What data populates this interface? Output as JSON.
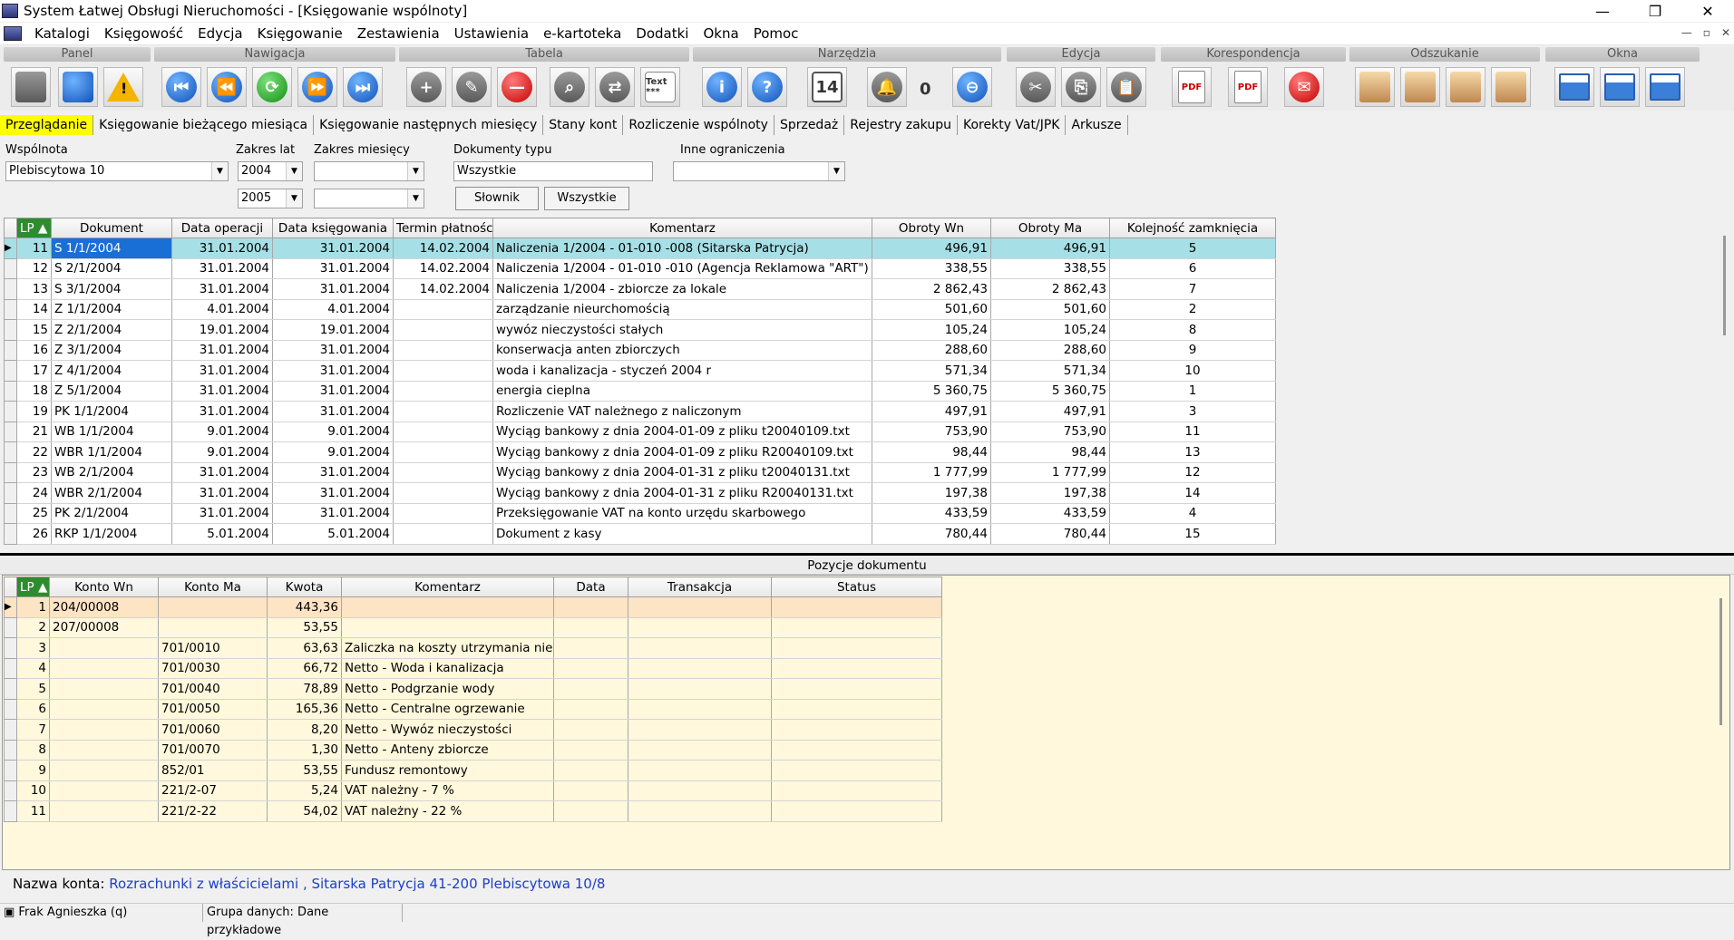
{
  "window": {
    "title": "System Łatwej Obsługi Nieruchomości - [Księgowanie wspólnoty]",
    "min": "—",
    "max": "❐",
    "close": "✕"
  },
  "menu": [
    "Katalogi",
    "Księgowość",
    "Edycja",
    "Księgowanie",
    "Zestawienia",
    "Ustawienia",
    "e-kartoteka",
    "Dodatki",
    "Okna",
    "Pomoc"
  ],
  "mdi": {
    "min": "—",
    "restore": "▫",
    "close": "✕"
  },
  "toolbar_groups": {
    "panel": "Panel",
    "nawigacja": "Nawigacja",
    "tabela": "Tabela",
    "narzedzia": "Narzędzia",
    "edycja": "Edycja",
    "korespondencja": "Korespondencja",
    "odszukanie": "Odszukanie",
    "okna": "Okna"
  },
  "toolbar_glyphs": {
    "first": "⏮",
    "prev": "⏪",
    "refresh": "⟳",
    "next": "⏩",
    "last": "⏭",
    "add": "+",
    "edit": "✎",
    "delete": "—",
    "binoculars": "⌕",
    "exchange": "⇄",
    "text": "Text ***",
    "info": "i",
    "help": "?",
    "calendar": "14",
    "bell": "🔔",
    "minus": "⊖",
    "cut": "✂",
    "copy": "⎘",
    "paste": "📋",
    "pdf1": "PDF",
    "pdf2": "PDF",
    "mail": "✉",
    "notif_count": "0"
  },
  "tabs": [
    "Przeglądanie",
    "Księgowanie bieżącego miesiąca",
    "Księgowanie następnych miesięcy",
    "Stany kont",
    "Rozliczenie wspólnoty",
    "Sprzedaż",
    "Rejestry zakupu",
    "Korekty Vat/JPK",
    "Arkusze"
  ],
  "filters": {
    "wspolnota_label": "Wspólnota",
    "wspolnota_value": "Plebiscytowa 10",
    "zakres_lat_label": "Zakres lat",
    "rok_od": "2004",
    "rok_do": "2005",
    "zakres_miesiecy_label": "Zakres miesięcy",
    "miesiac_od": "",
    "miesiac_do": "",
    "dokumenty_label": "Dokumenty typu",
    "dokumenty_value": "Wszystkie",
    "inne_label": "Inne ograniczenia",
    "inne_value": "",
    "slownik_btn": "Słownik",
    "wszystkie_btn": "Wszystkie",
    "arrow": "▼"
  },
  "documents": {
    "columns": [
      "LP ▲",
      "Dokument",
      "Data operacji",
      "Data księgowania",
      "Termin płatności",
      "Komentarz",
      "Obroty Wn",
      "Obroty Ma",
      "Kolejność zamknięcia"
    ],
    "rows": [
      [
        "11",
        "S 1/1/2004",
        "31.01.2004",
        "31.01.2004",
        "14.02.2004",
        "Naliczenia 1/2004 - 01-010 -008 (Sitarska Patrycja)",
        "496,91",
        "496,91",
        "5"
      ],
      [
        "12",
        "S 2/1/2004",
        "31.01.2004",
        "31.01.2004",
        "14.02.2004",
        "Naliczenia 1/2004 - 01-010 -010 (Agencja Reklamowa \"ART\")",
        "338,55",
        "338,55",
        "6"
      ],
      [
        "13",
        "S 3/1/2004",
        "31.01.2004",
        "31.01.2004",
        "14.02.2004",
        "Naliczenia 1/2004 - zbiorcze za lokale",
        "2 862,43",
        "2 862,43",
        "7"
      ],
      [
        "14",
        "Z 1/1/2004",
        "4.01.2004",
        "4.01.2004",
        "",
        "zarządzanie nieurchomością",
        "501,60",
        "501,60",
        "2"
      ],
      [
        "15",
        "Z 2/1/2004",
        "19.01.2004",
        "19.01.2004",
        "",
        "wywóz nieczystości stałych",
        "105,24",
        "105,24",
        "8"
      ],
      [
        "16",
        "Z 3/1/2004",
        "31.01.2004",
        "31.01.2004",
        "",
        "konserwacja anten zbiorczych",
        "288,60",
        "288,60",
        "9"
      ],
      [
        "17",
        "Z 4/1/2004",
        "31.01.2004",
        "31.01.2004",
        "",
        "woda i kanalizacja - styczeń 2004 r",
        "571,34",
        "571,34",
        "10"
      ],
      [
        "18",
        "Z 5/1/2004",
        "31.01.2004",
        "31.01.2004",
        "",
        "energia cieplna",
        "5 360,75",
        "5 360,75",
        "1"
      ],
      [
        "19",
        "PK 1/1/2004",
        "31.01.2004",
        "31.01.2004",
        "",
        "Rozliczenie VAT należnego z naliczonym",
        "497,91",
        "497,91",
        "3"
      ],
      [
        "21",
        "WB 1/1/2004",
        "9.01.2004",
        "9.01.2004",
        "",
        "Wyciąg bankowy z dnia 2004-01-09 z pliku t20040109.txt",
        "753,90",
        "753,90",
        "11"
      ],
      [
        "22",
        "WBR 1/1/2004",
        "9.01.2004",
        "9.01.2004",
        "",
        "Wyciąg bankowy z dnia 2004-01-09 z pliku R20040109.txt",
        "98,44",
        "98,44",
        "13"
      ],
      [
        "23",
        "WB 2/1/2004",
        "31.01.2004",
        "31.01.2004",
        "",
        "Wyciąg bankowy z dnia 2004-01-31 z pliku t20040131.txt",
        "1 777,99",
        "1 777,99",
        "12"
      ],
      [
        "24",
        "WBR 2/1/2004",
        "31.01.2004",
        "31.01.2004",
        "",
        "Wyciąg bankowy z dnia 2004-01-31 z pliku R20040131.txt",
        "197,38",
        "197,38",
        "14"
      ],
      [
        "25",
        "PK 2/1/2004",
        "31.01.2004",
        "31.01.2004",
        "",
        "Przeksięgowanie VAT na konto urzędu skarbowego",
        "433,59",
        "433,59",
        "4"
      ],
      [
        "26",
        "RKP 1/1/2004",
        "5.01.2004",
        "5.01.2004",
        "",
        "Dokument z kasy",
        "780,44",
        "780,44",
        "15"
      ]
    ]
  },
  "positions": {
    "title": "Pozycje dokumentu",
    "columns": [
      "LP ▲",
      "Konto Wn",
      "Konto Ma",
      "Kwota",
      "Komentarz",
      "Data",
      "Transakcja",
      "Status"
    ],
    "rows": [
      [
        "1",
        "204/00008",
        "",
        "443,36",
        "",
        "",
        "",
        ""
      ],
      [
        "2",
        "207/00008",
        "",
        "53,55",
        "",
        "",
        "",
        ""
      ],
      [
        "3",
        "",
        "701/0010",
        "63,63",
        "Zaliczka na koszty utrzymania nieruchomości",
        "",
        "",
        ""
      ],
      [
        "4",
        "",
        "701/0030",
        "66,72",
        "Netto - Woda i kanalizacja",
        "",
        "",
        ""
      ],
      [
        "5",
        "",
        "701/0040",
        "78,89",
        "Netto - Podgrzanie wody",
        "",
        "",
        ""
      ],
      [
        "6",
        "",
        "701/0050",
        "165,36",
        "Netto - Centralne ogrzewanie",
        "",
        "",
        ""
      ],
      [
        "7",
        "",
        "701/0060",
        "8,20",
        "Netto - Wywóz nieczystości",
        "",
        "",
        ""
      ],
      [
        "8",
        "",
        "701/0070",
        "1,30",
        "Netto - Anteny zbiorcze",
        "",
        "",
        ""
      ],
      [
        "9",
        "",
        "852/01",
        "53,55",
        "Fundusz remontowy",
        "",
        "",
        ""
      ],
      [
        "10",
        "",
        "221/2-07",
        "5,24",
        "VAT należny - 7 %",
        "",
        "",
        ""
      ],
      [
        "11",
        "",
        "221/2-22",
        "54,02",
        "VAT należny - 22 %",
        "",
        "",
        ""
      ]
    ]
  },
  "account": {
    "label": "Nazwa konta:",
    "value": "Rozrachunki z właścicielami , Sitarska Patrycja  41-200 Plebiscytowa 10/8"
  },
  "status": {
    "user": "Frak Agnieszka (q)",
    "group": "Grupa danych: Dane przykładowe"
  }
}
